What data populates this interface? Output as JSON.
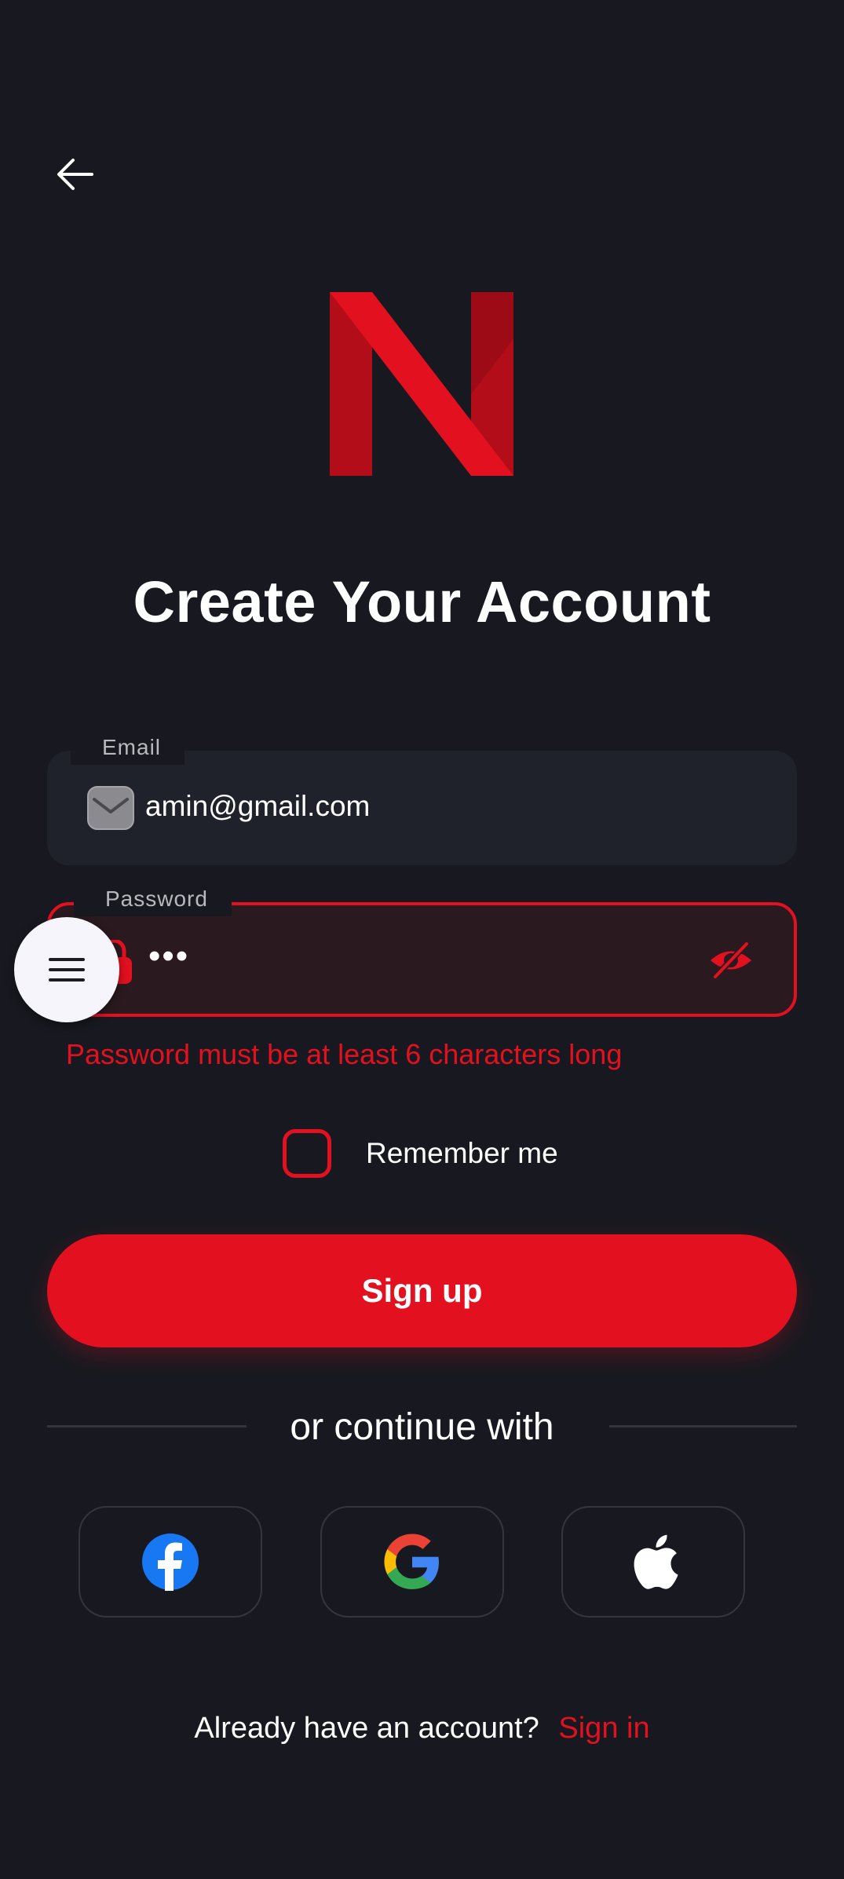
{
  "title": "Create Your Account",
  "form": {
    "email": {
      "label": "Email",
      "value": "amin@gmail.com"
    },
    "password": {
      "label": "Password",
      "value": "•••",
      "error": "Password must be at least 6 characters long"
    },
    "remember_label": "Remember me",
    "signup_label": "Sign up"
  },
  "social": {
    "divider_text": "or continue with",
    "providers": [
      "facebook-icon",
      "google-icon",
      "apple-icon"
    ]
  },
  "footer": {
    "prompt": "Already have an account?",
    "signin_label": "Sign in"
  },
  "colors": {
    "accent": "#e3101f",
    "background": "#181920",
    "field_bg": "#1f222a"
  }
}
